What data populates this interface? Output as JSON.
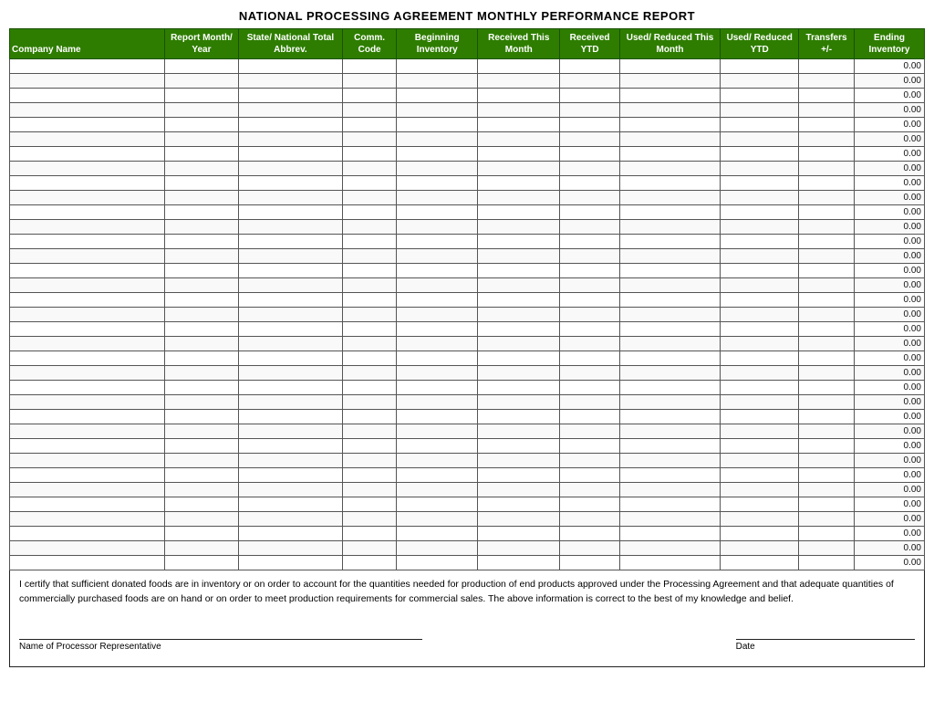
{
  "title": "NATIONAL PROCESSING AGREEMENT MONTHLY PERFORMANCE REPORT",
  "headers": {
    "company_name": "Company Name",
    "report_month_year": "Report Month/ Year",
    "state_national_total_abbrev": "State/ National Total Abbrev.",
    "comm_code": "Comm. Code",
    "beginning_inventory": "Beginning Inventory",
    "received_this_month": "Received This Month",
    "received_ytd": "Received  YTD",
    "used_reduced_this_month": "Used/ Reduced This Month",
    "used_reduced_ytd": "Used/ Reduced YTD",
    "transfers": "Transfers  +/-",
    "ending_inventory": "Ending Inventory"
  },
  "default_value": "0.00",
  "num_rows": 35,
  "footer_text": "I certify that sufficient donated foods are in inventory or on order to account for the quantities needed for production of end products approved under the Processing Agreement and that adequate quantities of commercially purchased foods are on hand or on order to meet production requirements for commercial sales.  The above information is correct to the best of my knowledge and belief.",
  "signature_label": "Name of Processor Representative",
  "date_label": "Date"
}
